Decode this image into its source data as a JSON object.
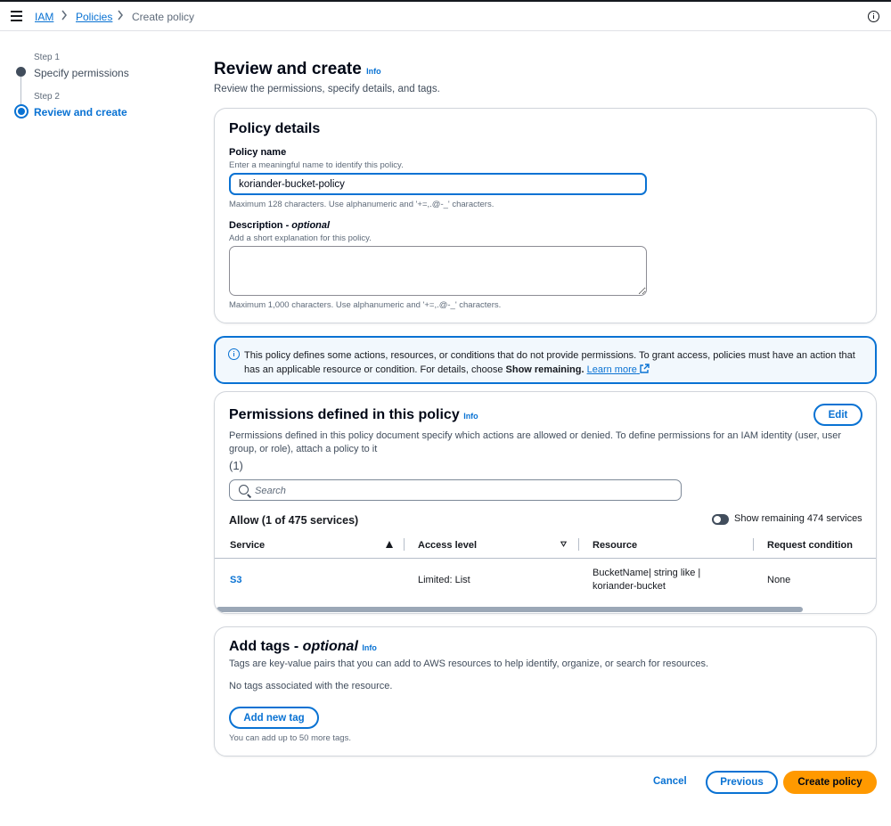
{
  "breadcrumb": {
    "items": [
      "IAM",
      "Policies",
      "Create policy"
    ]
  },
  "steps": [
    {
      "label": "Step 1",
      "title": "Specify permissions"
    },
    {
      "label": "Step 2",
      "title": "Review and create"
    }
  ],
  "page": {
    "title": "Review and create",
    "info": "Info",
    "subtitle": "Review the permissions, specify details, and tags."
  },
  "policy_details": {
    "heading": "Policy details",
    "name_label": "Policy name",
    "name_desc": "Enter a meaningful name to identify this policy.",
    "name_value": "koriander-bucket-policy",
    "name_constraint": "Maximum 128 characters. Use alphanumeric and '+=,.@-_' characters.",
    "desc_label": "Description",
    "desc_optional": "optional",
    "desc_desc": "Add a short explanation for this policy.",
    "desc_value": "",
    "desc_constraint": "Maximum 1,000 characters. Use alphanumeric and '+=,.@-_' characters."
  },
  "alert": {
    "text_1": "This policy defines some actions, resources, or conditions that do not provide permissions. To grant access, policies must have an action that has an applicable resource or condition. For details, choose ",
    "bold": "Show remaining.",
    "link": "Learn more"
  },
  "permissions": {
    "heading": "Permissions defined in this policy",
    "info": "Info",
    "edit_label": "Edit",
    "description": "Permissions defined in this policy document specify which actions are allowed or denied. To define permissions for an IAM identity (user, user group, or role), attach a policy to it",
    "count": "(1)",
    "search_placeholder": "Search",
    "allow_heading": "Allow (1 of 475 services)",
    "toggle_label": "Show remaining 474 services",
    "columns": [
      "Service",
      "Access level",
      "Resource",
      "Request condition"
    ],
    "rows": [
      {
        "service": "S3",
        "access": "Limited: List",
        "resource": "BucketName| string like | koriander-bucket",
        "condition": "None"
      }
    ]
  },
  "tags": {
    "heading": "Add tags",
    "optional": "optional",
    "info": "Info",
    "description": "Tags are key-value pairs that you can add to AWS resources to help identify, organize, or search for resources.",
    "empty": "No tags associated with the resource.",
    "add_label": "Add new tag",
    "limit": "You can add up to 50 more tags."
  },
  "footer": {
    "cancel": "Cancel",
    "previous": "Previous",
    "create": "Create policy"
  },
  "colors": {
    "accent": "#0972d3",
    "primary_button": "#ff9900",
    "alert_bg": "#f2f8fd"
  }
}
